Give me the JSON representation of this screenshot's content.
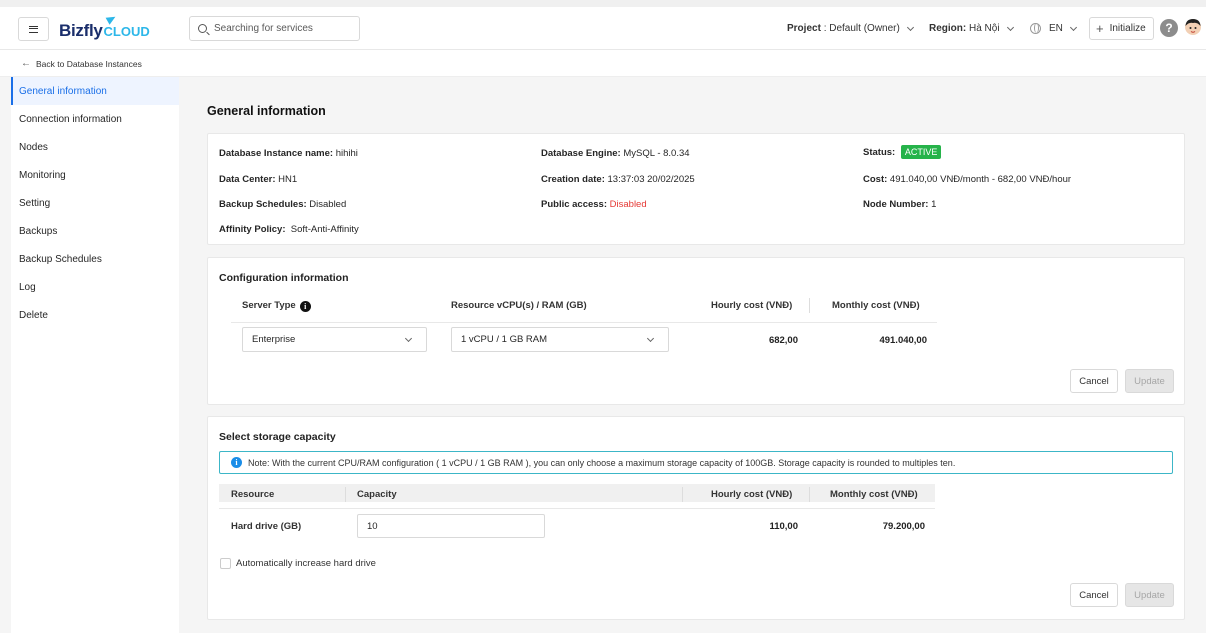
{
  "header": {
    "logo_main": "Bizfly",
    "logo_sub": "CLOUD",
    "search_placeholder": "Searching for services",
    "project_label": "Project",
    "project_value": ": Default (Owner)",
    "region_label": "Region:",
    "region_value": "Hà Nội",
    "language": "EN",
    "initialize_label": "Initialize",
    "help_label": "?"
  },
  "back_link": "Back to Database Instances",
  "sidebar": {
    "items": [
      {
        "label": "General information",
        "active": true
      },
      {
        "label": "Connection information"
      },
      {
        "label": "Nodes"
      },
      {
        "label": "Monitoring"
      },
      {
        "label": "Setting"
      },
      {
        "label": "Backups"
      },
      {
        "label": "Backup Schedules"
      },
      {
        "label": "Log"
      },
      {
        "label": "Delete"
      }
    ]
  },
  "general": {
    "title": "General information",
    "instance_name_label": "Database Instance name:",
    "instance_name": "hihihi",
    "engine_label": "Database Engine:",
    "engine": "MySQL - 8.0.34",
    "status_label": "Status:",
    "status": "ACTIVE",
    "datacenter_label": "Data Center:",
    "datacenter": "HN1",
    "creation_label": "Creation date:",
    "creation": "13:37:03 20/02/2025",
    "cost_label": "Cost:",
    "cost": "491.040,00 VNĐ/month - 682,00 VNĐ/hour",
    "backup_label": "Backup Schedules:",
    "backup": "Disabled",
    "public_label": "Public access:",
    "public": "Disabled",
    "node_label": "Node Number:",
    "node": "1",
    "affinity_label": "Affinity Policy:",
    "affinity": "Soft-Anti-Affinity"
  },
  "config": {
    "title": "Configuration information",
    "col_server_type": "Server Type",
    "col_resource": "Resource vCPU(s) / RAM (GB)",
    "col_hourly": "Hourly cost (VNĐ)",
    "col_monthly": "Monthly cost (VNĐ)",
    "server_type": "Enterprise",
    "resource": "1 vCPU / 1 GB RAM",
    "hourly": "682,00",
    "monthly": "491.040,00",
    "cancel": "Cancel",
    "update": "Update"
  },
  "storage": {
    "title": "Select storage capacity",
    "note": "Note: With the current CPU/RAM configuration ( 1 vCPU / 1 GB RAM ), you can only choose a maximum storage capacity of 100GB. Storage capacity is rounded to multiples ten.",
    "col_resource": "Resource",
    "col_capacity": "Capacity",
    "col_hourly": "Hourly cost (VNĐ)",
    "col_monthly": "Monthly cost (VNĐ)",
    "row_label": "Hard drive (GB)",
    "capacity": "10",
    "hourly": "110,00",
    "monthly": "79.200,00",
    "auto_increase": "Automatically increase hard drive",
    "cancel": "Cancel",
    "update": "Update"
  }
}
